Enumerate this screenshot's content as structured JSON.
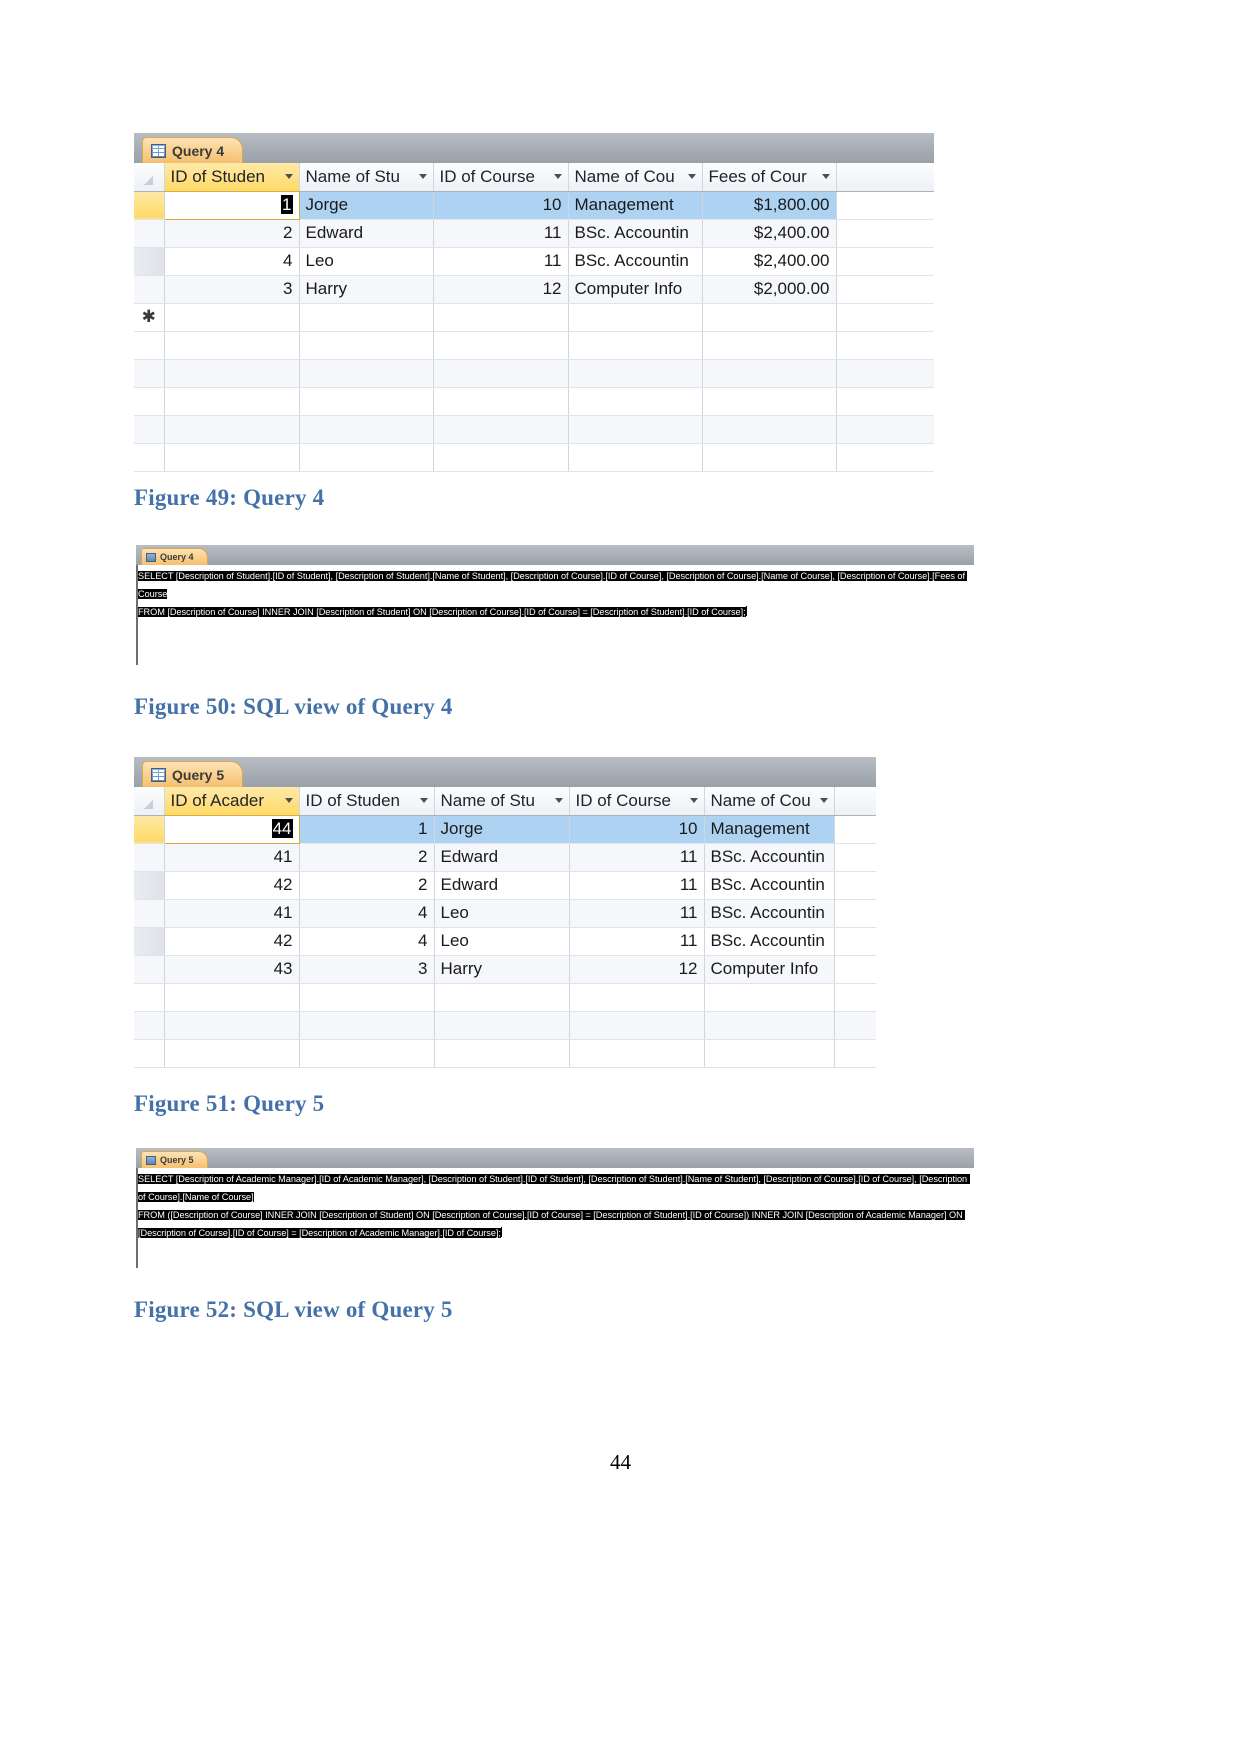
{
  "page": {
    "number": "44"
  },
  "figure49": {
    "caption": "Figure 49: Query 4",
    "tab_label": "Query 4",
    "columns": [
      "ID of Studen",
      "Name of Stu",
      "ID of Course",
      "Name of Cou",
      "Fees of Cour"
    ],
    "rows": [
      {
        "id_of_student": "1",
        "name_of_student": "Jorge",
        "id_of_course": "10",
        "name_of_course": "Management",
        "fees_of_course": "$1,800.00"
      },
      {
        "id_of_student": "2",
        "name_of_student": "Edward",
        "id_of_course": "11",
        "name_of_course": "BSc. Accountin",
        "fees_of_course": "$2,400.00"
      },
      {
        "id_of_student": "4",
        "name_of_student": "Leo",
        "id_of_course": "11",
        "name_of_course": "BSc. Accountin",
        "fees_of_course": "$2,400.00"
      },
      {
        "id_of_student": "3",
        "name_of_student": "Harry",
        "id_of_course": "12",
        "name_of_course": "Computer Info",
        "fees_of_course": "$2,000.00"
      }
    ],
    "new_row_marker": "✱"
  },
  "figure50": {
    "caption": "Figure 50: SQL view of Query 4",
    "tab_label": "Query 4",
    "sql_line_1": "SELECT [Description of Student].[ID of Student], [Description of Student].[Name of Student], [Description of Course].[ID of Course], [Description of Course].[Name of Course], [Description of Course].[Fees of Course",
    "sql_line_2": "FROM [Description of Course] INNER JOIN [Description of Student] ON [Description of Course].[ID of Course] = [Description of Student].[ID of Course];"
  },
  "figure51": {
    "caption": "Figure 51: Query 5",
    "tab_label": "Query 5",
    "columns": [
      "ID of Acader",
      "ID of Studen",
      "Name of Stu",
      "ID of Course",
      "Name of Cou"
    ],
    "rows": [
      {
        "id_of_academic_manager": "44",
        "id_of_student": "1",
        "name_of_student": "Jorge",
        "id_of_course": "10",
        "name_of_course": "Management"
      },
      {
        "id_of_academic_manager": "41",
        "id_of_student": "2",
        "name_of_student": "Edward",
        "id_of_course": "11",
        "name_of_course": "BSc. Accountin"
      },
      {
        "id_of_academic_manager": "42",
        "id_of_student": "2",
        "name_of_student": "Edward",
        "id_of_course": "11",
        "name_of_course": "BSc. Accountin"
      },
      {
        "id_of_academic_manager": "41",
        "id_of_student": "4",
        "name_of_student": "Leo",
        "id_of_course": "11",
        "name_of_course": "BSc. Accountin"
      },
      {
        "id_of_academic_manager": "42",
        "id_of_student": "4",
        "name_of_student": "Leo",
        "id_of_course": "11",
        "name_of_course": "BSc. Accountin"
      },
      {
        "id_of_academic_manager": "43",
        "id_of_student": "3",
        "name_of_student": "Harry",
        "id_of_course": "12",
        "name_of_course": "Computer Info"
      }
    ]
  },
  "figure52": {
    "caption": "Figure 52: SQL view of Query 5",
    "tab_label": "Query 5",
    "sql_line_1": "SELECT [Description of Academic Manager].[ID of Academic Manager], [Description of Student].[ID of Student], [Description of Student].[Name of Student], [Description of Course].[ID of Course], [Description of Course].[Name of Course]",
    "sql_line_2": "FROM ([Description of Course] INNER JOIN [Description of Student] ON [Description of Course].[ID of Course] = [Description of Student].[ID of Course]) INNER JOIN [Description of Academic Manager] ON [Description of Course].[ID of Course] = [Description of Academic Manager].[ID of Course];"
  },
  "colors": {
    "caption_blue": "#4472a8",
    "selected_row": "#aed3f2",
    "sorted_header": "#ffd966",
    "tab_orange": "#f9cf8c"
  }
}
